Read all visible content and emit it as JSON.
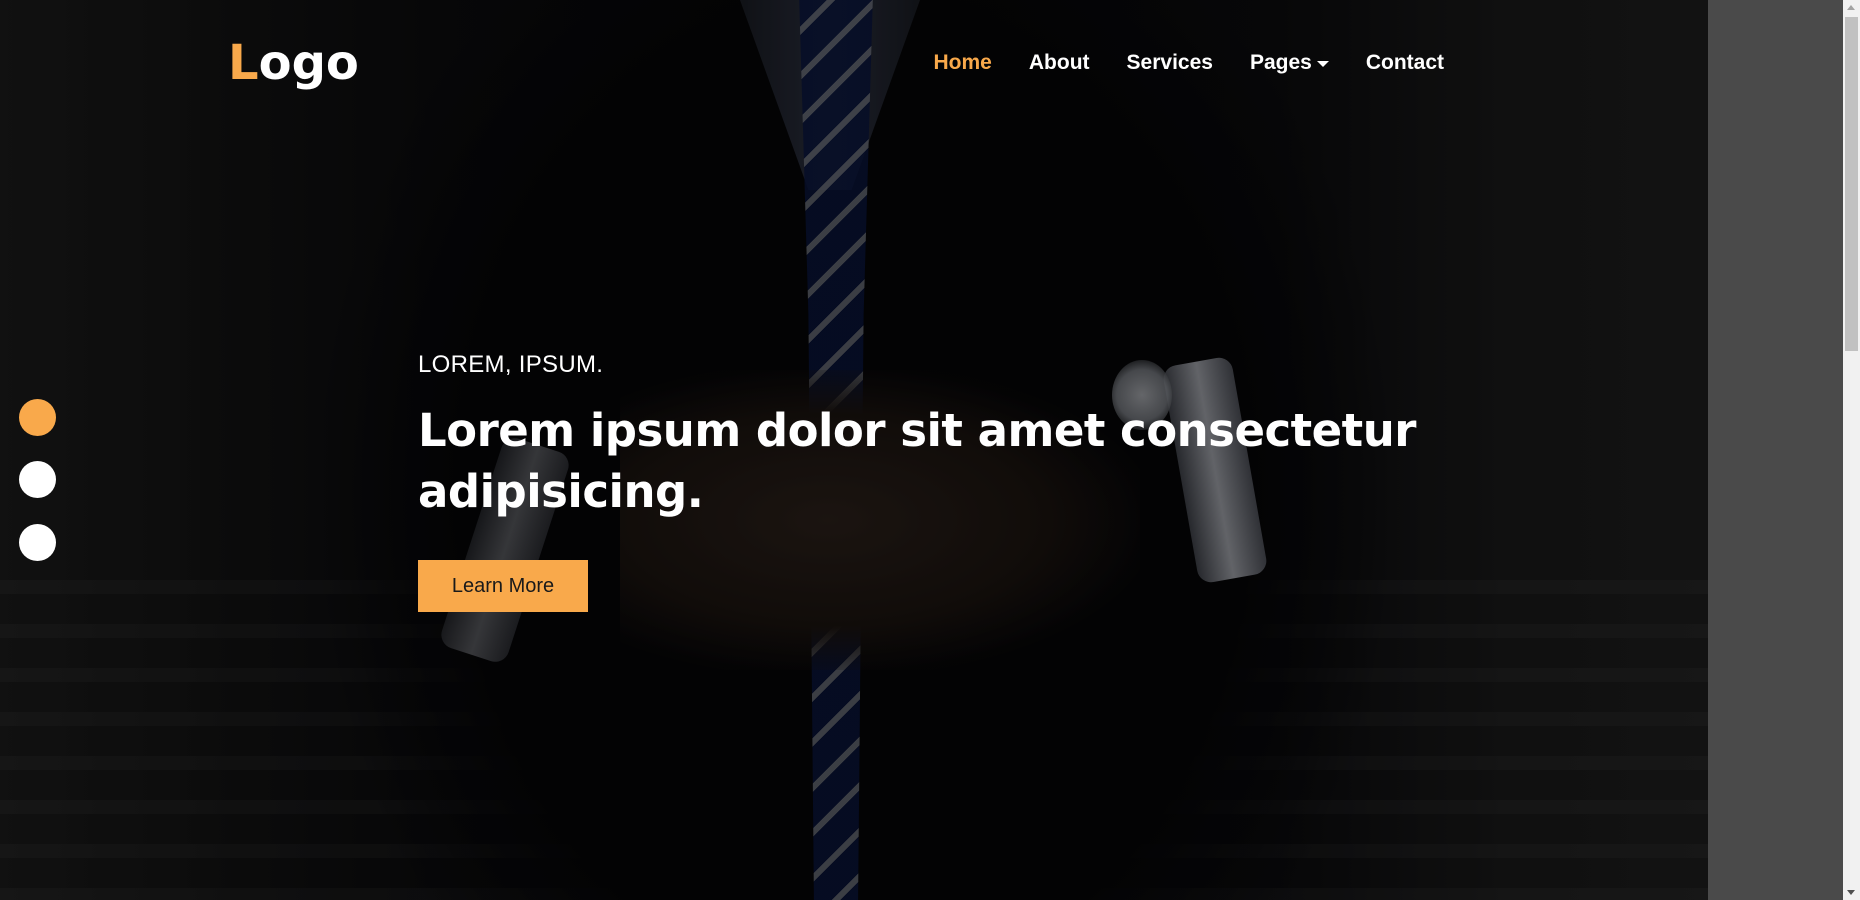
{
  "navbar": {
    "logo_first_letter": "L",
    "logo_rest": "ogo",
    "links": [
      {
        "label": "Home",
        "active": true
      },
      {
        "label": "About",
        "active": false
      },
      {
        "label": "Services",
        "active": false
      },
      {
        "label": "Pages",
        "active": false,
        "dropdown": true
      },
      {
        "label": "Contact",
        "active": false
      }
    ]
  },
  "carousel": {
    "slide_count": 3,
    "active_slide": 1
  },
  "hero": {
    "kicker": "LOREM, IPSUM.",
    "headline": "Lorem ipsum dolor sit amet consectetur adipisicing.",
    "cta_label": "Learn More"
  },
  "colors": {
    "accent": "#f9a94b",
    "text": "#ffffff",
    "page_side": "#4a4a4a"
  },
  "icons": {
    "dropdown": "caret-down-icon"
  }
}
